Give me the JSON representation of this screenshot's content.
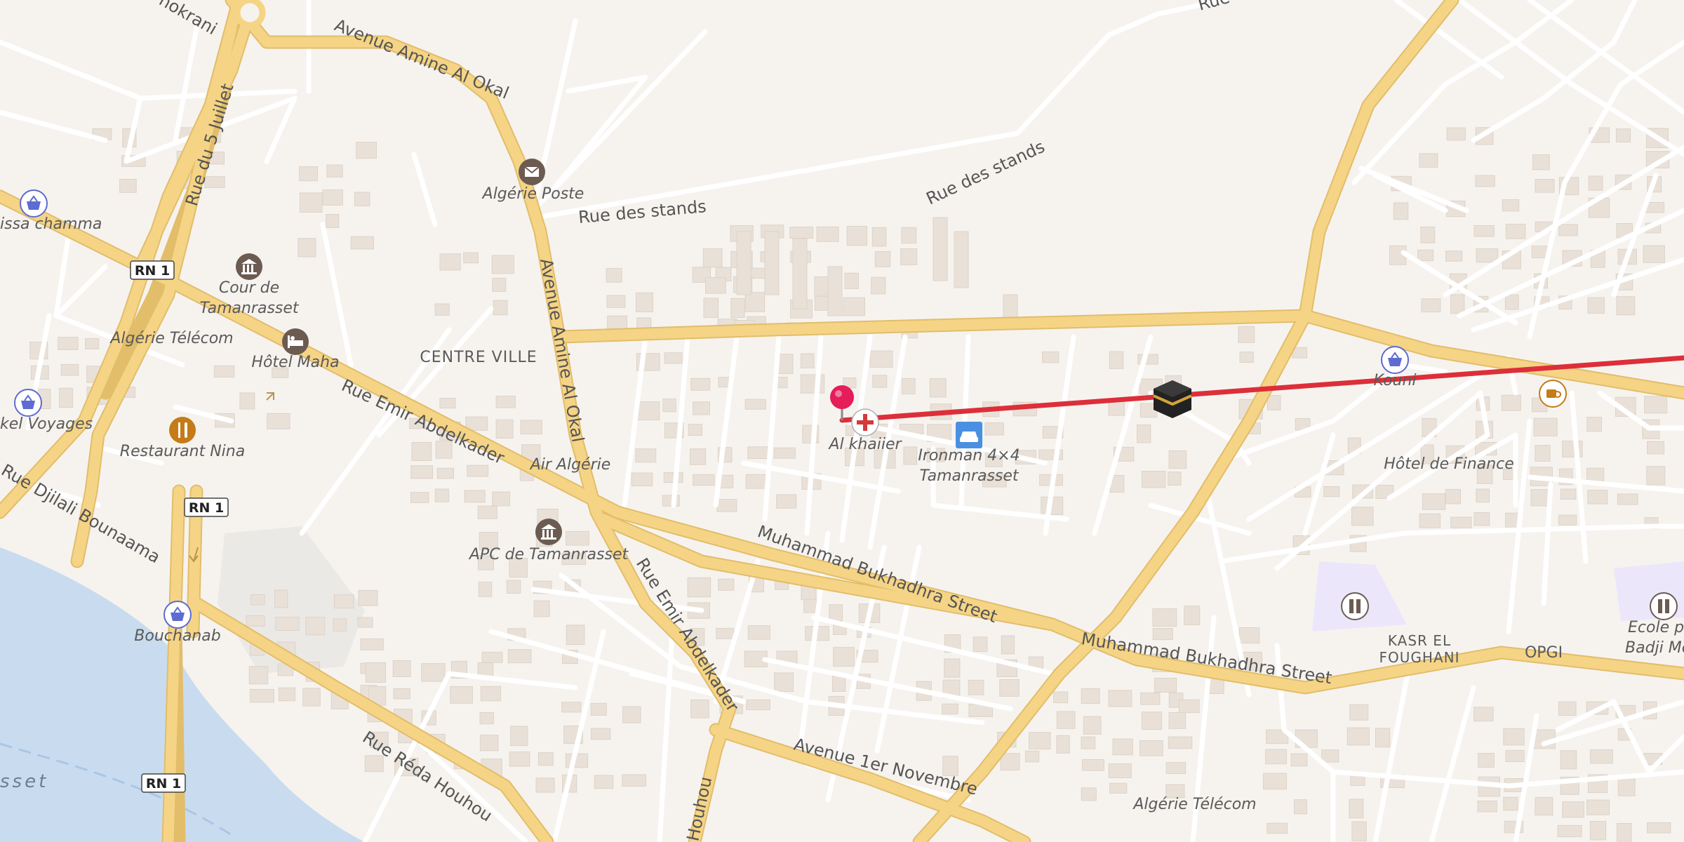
{
  "map": {
    "colors": {
      "land": "#f6f3ef",
      "water": "#c9dcef",
      "major_road": "#f5d486",
      "major_road_casing": "#e2bd6a",
      "minor_road": "#ffffff",
      "building": "#e9e1d8",
      "route_line": "#dc2f3a",
      "marker": "#e51d58",
      "poi_shop": "#5e6bd1",
      "poi_civic": "#6b5b51",
      "poi_food": "#c47b18",
      "poi_car": "#4a90e2",
      "school_area": "#ece6fb"
    },
    "road_labels": {
      "avenue_amine_al_okal_1": "Avenue Amine Al Okal",
      "avenue_amine_al_okal_2": "Avenue Amine Al Okal",
      "rue_du_5_juillet": "Rue du 5 Juillet",
      "rue_des_stands_1": "Rue des stands",
      "rue_des_stands_2": "Rue des stands",
      "rue_emir_abdelkader_1": "Rue Emir Abdelkader",
      "rue_emir_abdelkader_2": "Rue Emir Abdelkader",
      "rue_djilali_bounaama": "Rue Djilali Bounaama",
      "muhammad_bukhadhra_1": "Muhammad Bukhadhra Street",
      "muhammad_bukhadhra_2": "Muhammad Bukhadhra Street",
      "rue_reda_houhou": "Rue Réda Houhou",
      "avenue_1er_novembre": "Avenue 1er Novembre",
      "houhou_fragment": "Houhou",
      "rue_fragment_top": "Rue",
      "hokrani_fragment": "hokrani"
    },
    "shields": {
      "rn1_a": "RN 1",
      "rn1_b": "RN 1",
      "rn1_c": "RN 1"
    },
    "place_labels": {
      "algerie_poste": "Algérie Poste",
      "cour_de": "Cour de",
      "tamanrasset": "Tamanrasset",
      "algerie_telecom_1": "Algérie Télécom",
      "hotel_maha": "Hôtel Maha",
      "centre_ville": "CENTRE VILLE",
      "restaurant_nina": "Restaurant Nina",
      "air_algerie": "Air Algérie",
      "apc_de_tamanrasset": "APC de Tamanrasset",
      "bouchanab": "Bouchanab",
      "al_khaiier": "Al khaiier",
      "ironman_line1": "Ironman 4×4",
      "ironman_line2": "Tamanrasset",
      "kouni": "Kouni",
      "hotel_de_finance": "Hôtel de Finance",
      "kasr_el": "KASR EL",
      "foughani": "FOUGHANI",
      "opgi": "OPGI",
      "ecole_line1": "Ecole prim",
      "ecole_line2": "Badji Mokh",
      "algerie_telecom_2": "Algérie Télécom",
      "issa_chamma": "issa chamma",
      "kel_voyages": "kel Voyages",
      "water_label": "sset"
    },
    "icons": {
      "post": "envelope-icon",
      "civic": "columns-icon",
      "hotel": "bed-icon",
      "restaurant": "fork-knife-icon",
      "shop": "basket-icon",
      "pharmacy": "cross-icon",
      "car": "car-icon",
      "mosque": "kaaba-icon",
      "cafe": "coffee-icon",
      "school": "book-icon",
      "pin": "map-pin-icon"
    }
  }
}
